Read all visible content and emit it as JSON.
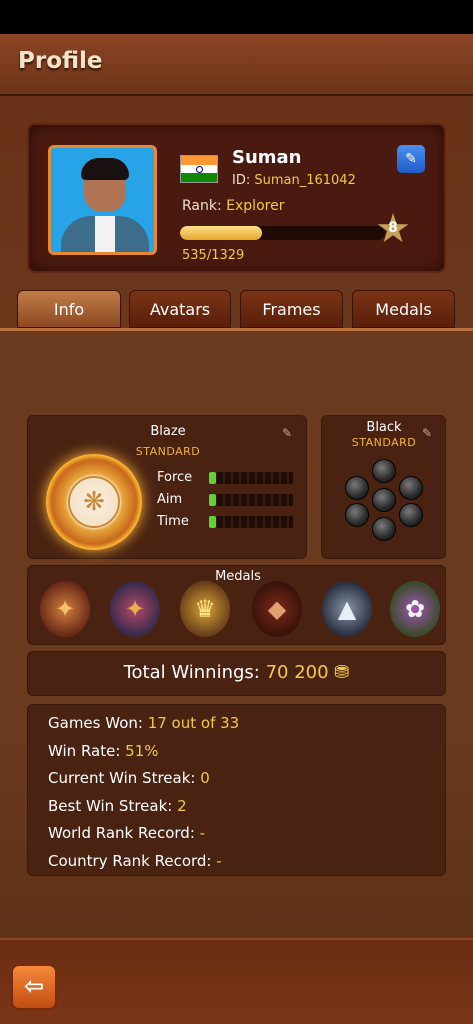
{
  "header": {
    "title": "Profile"
  },
  "profile": {
    "name": "Suman",
    "id_label": "ID: ",
    "id_value": "Suman_161042",
    "rank_label": "Rank: ",
    "rank_value": "Explorer",
    "level": "8",
    "xp_text": "535/1329",
    "xp_fraction": 0.402,
    "flag": "india-flag-icon"
  },
  "tabs": [
    {
      "label": "Info",
      "active": true
    },
    {
      "label": "Avatars",
      "active": false
    },
    {
      "label": "Frames",
      "active": false
    },
    {
      "label": "Medals",
      "active": false
    }
  ],
  "striker": {
    "name": "Blaze",
    "type": "STANDARD",
    "stats": [
      {
        "label": "Force",
        "level": 0.08
      },
      {
        "label": "Aim",
        "level": 0.08
      },
      {
        "label": "Time",
        "level": 0.08
      }
    ]
  },
  "coins": {
    "name": "Black",
    "type": "STANDARD"
  },
  "medals": {
    "title": "Medals",
    "items": [
      "medal-1-icon",
      "medal-2-icon",
      "medal-3-icon",
      "medal-4-icon",
      "medal-5-icon",
      "medal-6-icon"
    ]
  },
  "winnings": {
    "label": "Total Winnings: ",
    "value": "70 200"
  },
  "stats": [
    {
      "label": "Games Won: ",
      "value": "17 out of 33"
    },
    {
      "label": "Win Rate: ",
      "value": "51%"
    },
    {
      "label": "Current Win Streak: ",
      "value": "0"
    },
    {
      "label": "Best Win Streak: ",
      "value": "2"
    },
    {
      "label": "World Rank Record: ",
      "value": "-"
    },
    {
      "label": "Country Rank Record: ",
      "value": "-"
    }
  ],
  "colors": {
    "accent": "#f2c94c",
    "background": "#6b3a1e",
    "stat_fill": "#5fd23a"
  }
}
